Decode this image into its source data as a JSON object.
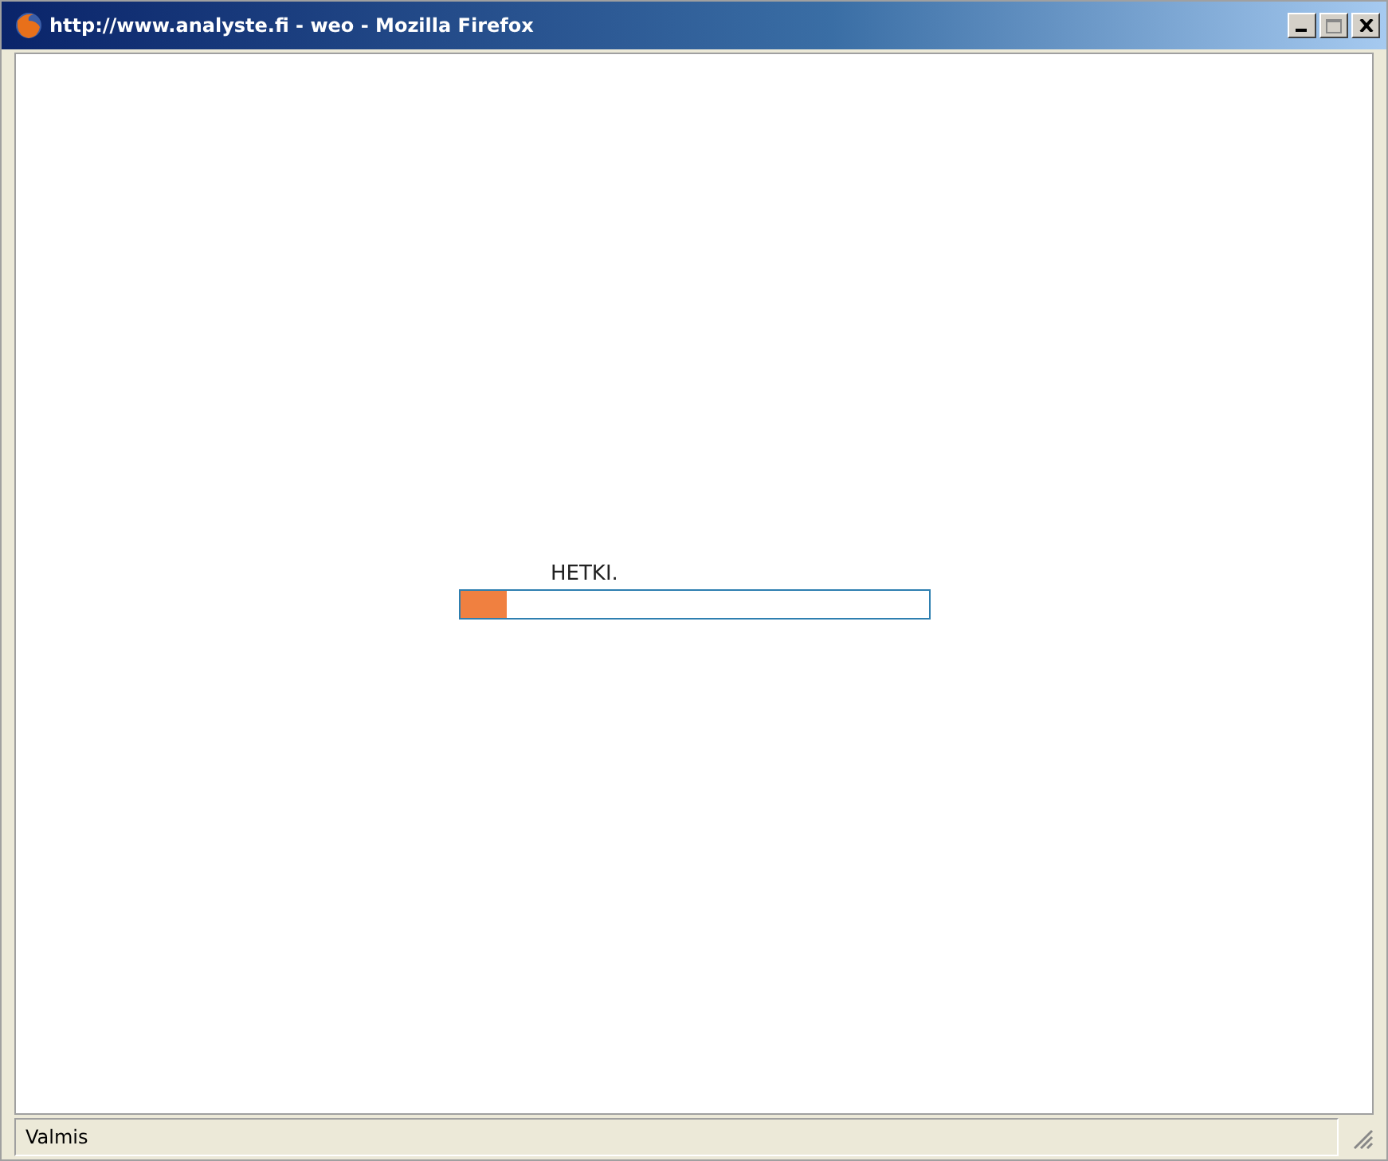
{
  "window": {
    "title": "http://www.analyste.fi - weo - Mozilla Firefox"
  },
  "loader": {
    "message": "HETKI.",
    "level": 0.1
  },
  "status_bar": {
    "text": "Valmis"
  }
}
